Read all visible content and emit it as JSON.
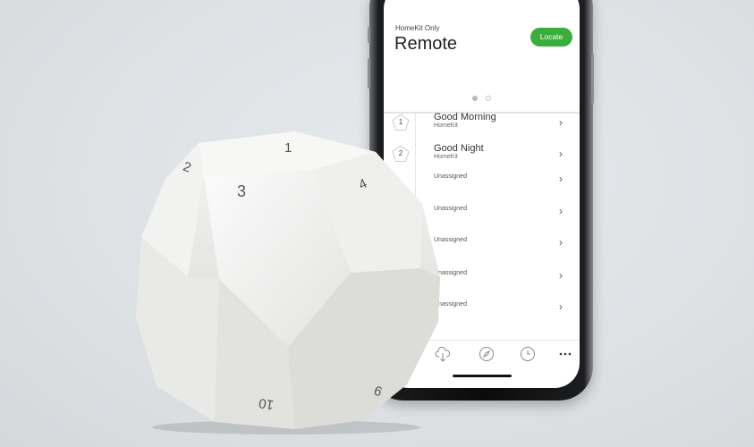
{
  "app": {
    "subtitle": "HomeKit Only",
    "title": "Remote",
    "locate_label": "Locate"
  },
  "pager": {
    "pages": 2,
    "active": 1
  },
  "scenes": [
    {
      "number": "1",
      "name": "Good Morning",
      "type": "HomeKit"
    },
    {
      "number": "2",
      "name": "Good Night",
      "type": "HomeKit"
    },
    {
      "name": "Unassigned"
    },
    {
      "name": "Unassigned"
    },
    {
      "name": "Unassigned"
    },
    {
      "name": "Unassigned"
    },
    {
      "name": "Unassigned"
    }
  ],
  "tabs": [
    "cloud-download-icon",
    "compass-icon",
    "clock-icon",
    "more-icon"
  ],
  "device": {
    "face_numbers": [
      "1",
      "2",
      "3",
      "4",
      "10",
      "9"
    ]
  },
  "colors": {
    "accent": "#3aad3c",
    "background": "#dfe3e6"
  }
}
